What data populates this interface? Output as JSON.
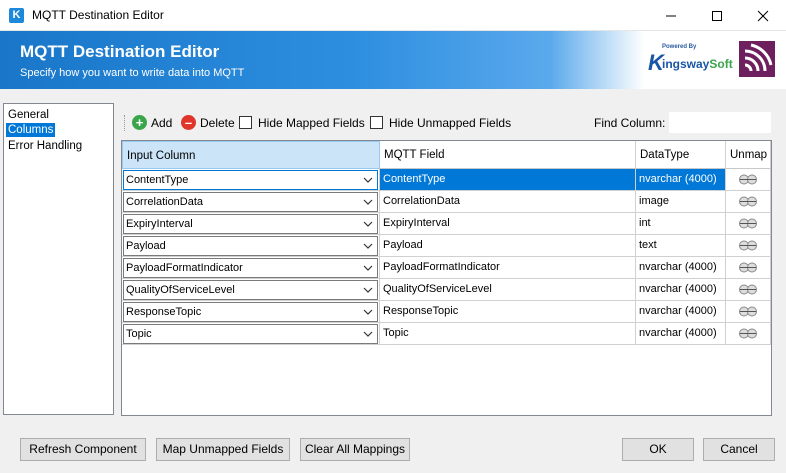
{
  "window": {
    "title": "MQTT Destination Editor",
    "app_icon": "K"
  },
  "banner": {
    "title": "MQTT Destination Editor",
    "subtitle": "Specify how you want to write data into MQTT",
    "logo_powered": "Powered By",
    "logo_k": "K",
    "logo_word_a": "ingsway",
    "logo_word_b": "Soft"
  },
  "nav": {
    "items": [
      "General",
      "Columns",
      "Error Handling"
    ],
    "active": "Columns"
  },
  "toolbar": {
    "add_label": "Add",
    "delete_label": "Delete",
    "hide_mapped_label": "Hide Mapped Fields",
    "hide_unmapped_label": "Hide Unmapped Fields",
    "find_label": "Find Column:",
    "find_value": ""
  },
  "grid": {
    "headers": [
      "Input Column",
      "MQTT Field",
      "DataType",
      "Unmap"
    ],
    "rows": [
      {
        "input": "ContentType",
        "field": "ContentType",
        "type": "nvarchar (4000)"
      },
      {
        "input": "CorrelationData",
        "field": "CorrelationData",
        "type": "image"
      },
      {
        "input": "ExpiryInterval",
        "field": "ExpiryInterval",
        "type": "int"
      },
      {
        "input": "Payload",
        "field": "Payload",
        "type": "text"
      },
      {
        "input": "PayloadFormatIndicator",
        "field": "PayloadFormatIndicator",
        "type": "nvarchar (4000)"
      },
      {
        "input": "QualityOfServiceLevel",
        "field": "QualityOfServiceLevel",
        "type": "nvarchar (4000)"
      },
      {
        "input": "ResponseTopic",
        "field": "ResponseTopic",
        "type": "nvarchar (4000)"
      },
      {
        "input": "Topic",
        "field": "Topic",
        "type": "nvarchar (4000)"
      }
    ]
  },
  "buttons": {
    "refresh": "Refresh Component",
    "map_unmapped": "Map Unmapped Fields",
    "clear_all": "Clear All Mappings",
    "ok": "OK",
    "cancel": "Cancel"
  },
  "colors": {
    "accent": "#0078d7",
    "banner": "#1976c8",
    "add_green": "#3aa54a",
    "delete_red": "#e0352b"
  }
}
